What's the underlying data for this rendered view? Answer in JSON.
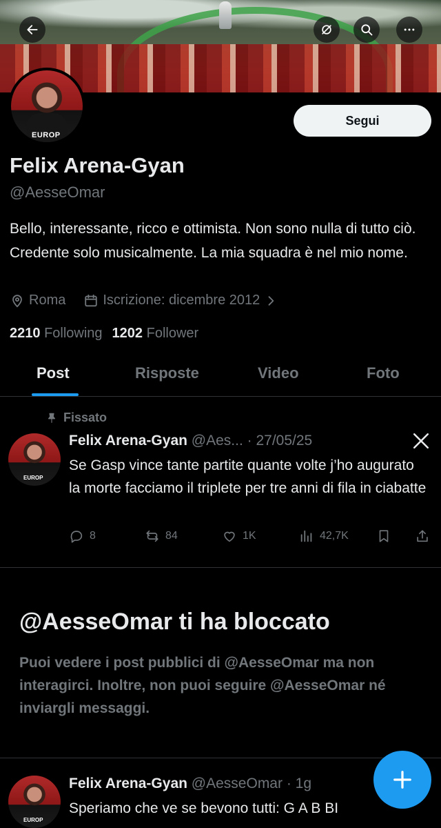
{
  "header": {
    "back_icon": "arrow-left-icon",
    "grok_icon": "grok-icon",
    "search_icon": "search-icon",
    "more_icon": "more-horizontal-icon"
  },
  "profile": {
    "name": "Felix Arena-Gyan",
    "handle": "@AesseOmar",
    "follow_label": "Segui",
    "bio": "Bello, interessante, ricco e ottimista. Non sono nulla di tutto ciò. Credente solo musicalmente. La mia squadra è nel mio nome.",
    "location": "Roma",
    "joined": "Iscrizione: dicembre 2012",
    "following_count": "2210",
    "following_label": "Following",
    "followers_count": "1202",
    "followers_label": "Follower",
    "avatar_sponsor": "EUROP"
  },
  "tabs": [
    {
      "label": "Post",
      "active": true
    },
    {
      "label": "Risposte",
      "active": false
    },
    {
      "label": "Video",
      "active": false
    },
    {
      "label": "Foto",
      "active": false
    }
  ],
  "pinned_post": {
    "pinned_label": "Fissato",
    "author": "Felix Arena-Gyan",
    "handle": "@Aes...",
    "date": "· 27/05/25",
    "text": "Se Gasp vince tante partite quante volte j’ho augurato la morte facciamo il triplete per tre anni di fila in ciabatte",
    "replies": "8",
    "reposts": "84",
    "likes": "1K",
    "views": "42,7K"
  },
  "blocked": {
    "title": "@AesseOmar ti ha bloccato",
    "message": "Puoi vedere i post pubblici di @AesseOmar ma non interagirci. Inoltre, non puoi seguire @AesseOmar né inviargli messaggi."
  },
  "second_post": {
    "author": "Felix Arena-Gyan",
    "handle": "@AesseOmar",
    "time": "· 1g",
    "text": "Speriamo che ve se bevono tutti: G A B BI"
  },
  "colors": {
    "accent": "#1d9bf0",
    "background": "#000000",
    "text_primary": "#e7e9ea",
    "text_secondary": "#71767b",
    "divider": "#2f3336"
  }
}
